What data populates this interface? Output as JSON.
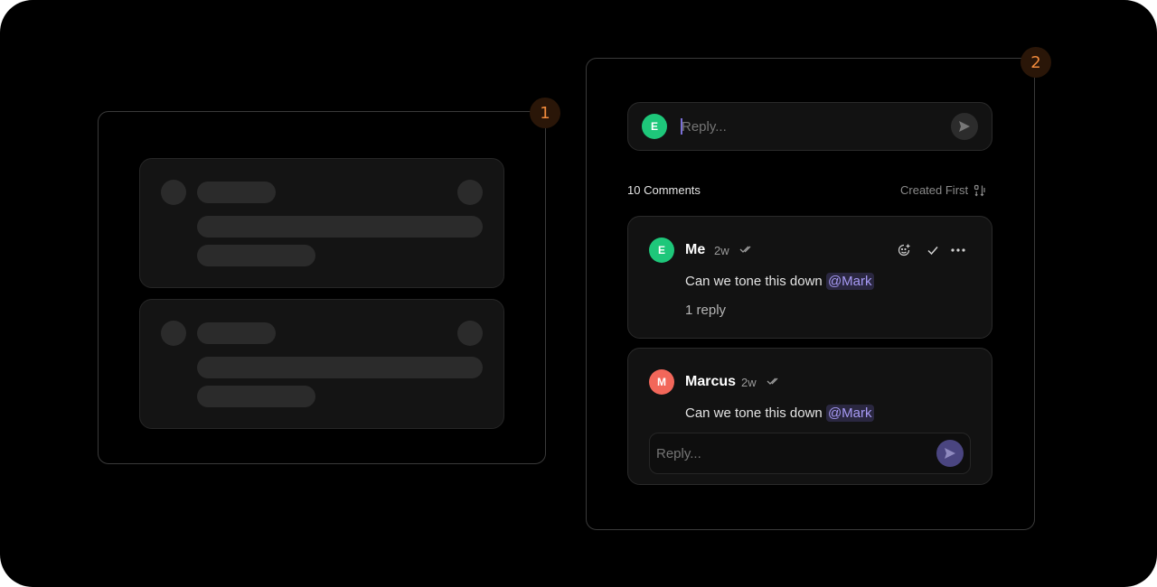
{
  "badges": {
    "panel1": "1",
    "panel2": "2"
  },
  "composer": {
    "avatar_initial": "E",
    "placeholder": "Reply..."
  },
  "comments_header": {
    "count_label": "10 Comments",
    "sort_label": "Created First"
  },
  "comments": [
    {
      "author": "Me",
      "avatar_initial": "E",
      "time": "2w",
      "text_prefix": "Can we tone this down ",
      "mention": "@Mark",
      "replies_label": "1 reply"
    },
    {
      "author": "Marcus",
      "avatar_initial": "M",
      "time": "2w",
      "text_prefix": "Can we tone this down ",
      "mention": "@Mark",
      "reply_placeholder": "Reply..."
    }
  ],
  "icons": {
    "read_ticks": "double-check-icon",
    "add_reaction": "emoji-add-icon",
    "resolve": "check-icon",
    "more": "more-horizontal-icon",
    "send": "send-icon",
    "sort": "sort-icon"
  },
  "colors": {
    "background": "#000000",
    "accent_badge": "#f08a3c",
    "avatar_me": "#1ec77a",
    "avatar_marcus": "#f2675a",
    "mention": "#a79af5"
  }
}
